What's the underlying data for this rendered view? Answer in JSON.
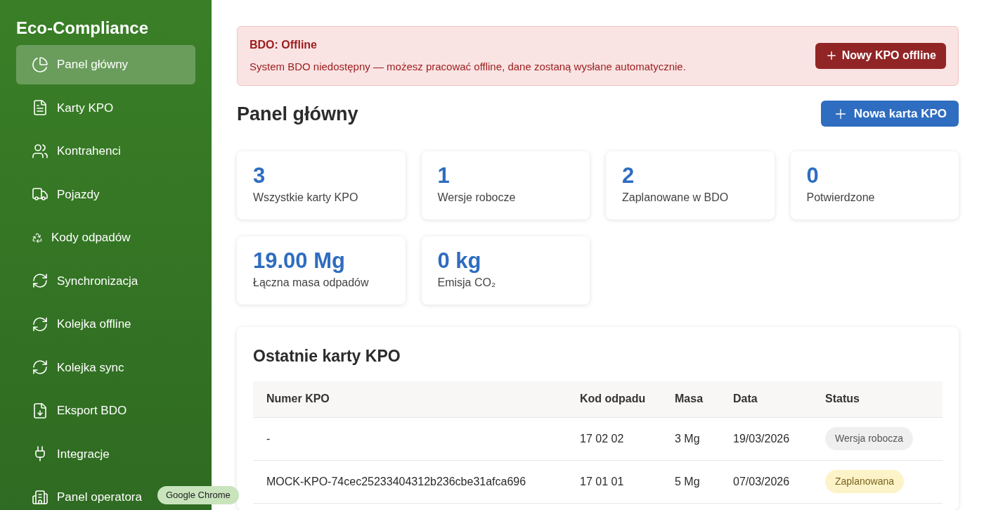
{
  "sidebar": {
    "title": "Eco-Compliance",
    "items": [
      {
        "label": "Panel główny",
        "selected": true
      },
      {
        "label": "Karty KPO",
        "selected": false
      },
      {
        "label": "Kontrahenci",
        "selected": false
      },
      {
        "label": "Pojazdy",
        "selected": false
      },
      {
        "label": "Kody odpadów",
        "selected": false
      },
      {
        "label": "Synchronizacja",
        "selected": false
      },
      {
        "label": "Kolejka offline",
        "selected": false
      },
      {
        "label": "Kolejka sync",
        "selected": false
      },
      {
        "label": "Eksport BDO",
        "selected": false
      },
      {
        "label": "Integracje",
        "selected": false
      },
      {
        "label": "Panel operatora",
        "selected": false
      }
    ]
  },
  "alert": {
    "title": "BDO: Offline",
    "message": "System BDO niedostępny — możesz pracować offline, dane zostaną wysłane automatycznie.",
    "button": "Nowy KPO offline"
  },
  "page_title": "Panel główny",
  "new_button": "Nowa karta KPO",
  "stats": [
    {
      "value": "3",
      "label": "Wszystkie karty KPO"
    },
    {
      "value": "1",
      "label": "Wersje robocze"
    },
    {
      "value": "2",
      "label": "Zaplanowane w BDO"
    },
    {
      "value": "0",
      "label": "Potwierdzone"
    },
    {
      "value": "19.00 Mg",
      "label": "Łączna masa odpadów"
    },
    {
      "value": "0 kg",
      "label": "Emisja CO₂"
    }
  ],
  "recent": {
    "title": "Ostatnie karty KPO",
    "columns": [
      "Numer KPO",
      "Kod odpadu",
      "Masa",
      "Data",
      "Status"
    ],
    "rows": [
      {
        "cells": [
          "-",
          "17 02 02",
          "3 Mg",
          "19/03/2026"
        ],
        "status": "Wersja robocza",
        "kind": "draft"
      },
      {
        "cells": [
          "MOCK-KPO-74cec25233404312b236cbe31afca696",
          "17 01 01",
          "5 Mg",
          "07/03/2026"
        ],
        "status": "Zaplanowana",
        "kind": "planned"
      }
    ]
  },
  "tooltip": "Google Chrome"
}
